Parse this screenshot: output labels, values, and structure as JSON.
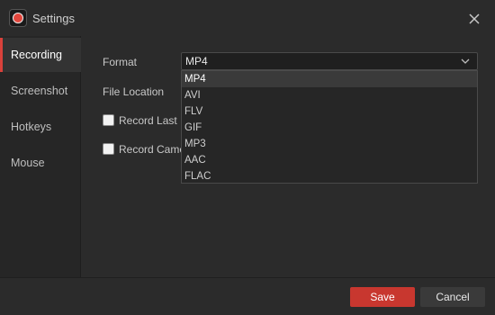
{
  "window": {
    "title": "Settings"
  },
  "sidebar": {
    "items": [
      {
        "label": "Recording",
        "active": true
      },
      {
        "label": "Screenshot",
        "active": false
      },
      {
        "label": "Hotkeys",
        "active": false
      },
      {
        "label": "Mouse",
        "active": false
      }
    ]
  },
  "form": {
    "format_label": "Format",
    "format_value": "MP4",
    "file_location_label": "File Location",
    "record_last_label": "Record Last",
    "record_last_checked": false,
    "record_camera_label": "Record Came",
    "record_camera_checked": false
  },
  "dropdown": {
    "options": [
      "MP4",
      "AVI",
      "FLV",
      "GIF",
      "MP3",
      "AAC",
      "FLAC"
    ],
    "selected": "MP4"
  },
  "footer": {
    "save_label": "Save",
    "cancel_label": "Cancel"
  },
  "colors": {
    "accent": "#d9413b",
    "save_button": "#c8372f",
    "background": "#2b2b2b"
  },
  "icons": {
    "app": "record-logo-icon",
    "close": "close-icon",
    "dropdown": "chevron-down-icon"
  }
}
